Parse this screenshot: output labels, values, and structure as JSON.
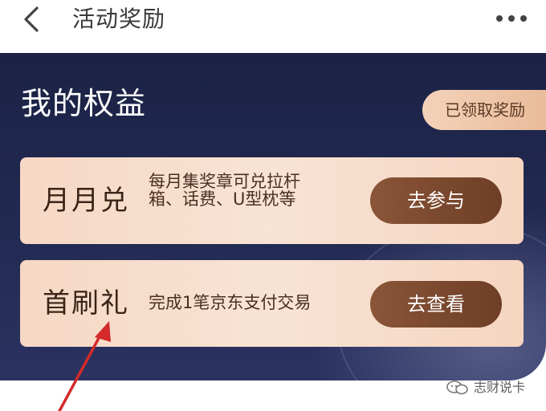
{
  "header": {
    "title": "活动奖励",
    "back_icon": "chevron-left-icon",
    "more_icon": "ellipsis-icon"
  },
  "panel": {
    "title": "我的权益",
    "claimed_label": "已领取奖励"
  },
  "cards": [
    {
      "name": "月月兑",
      "desc": "每月集奖章可兑拉杆箱、话费、U型枕等",
      "button": "去参与"
    },
    {
      "name": "首刷礼",
      "desc": "完成1笔京东支付交易",
      "button": "去查看"
    }
  ],
  "watermark": {
    "text": "志财说卡",
    "icon": "wechat-icon"
  },
  "colors": {
    "panel_bg": "#232a52",
    "card_bg": "#f6d8c4",
    "button_bg": "#7c4a30",
    "annotation_arrow": "#d42a2a"
  }
}
